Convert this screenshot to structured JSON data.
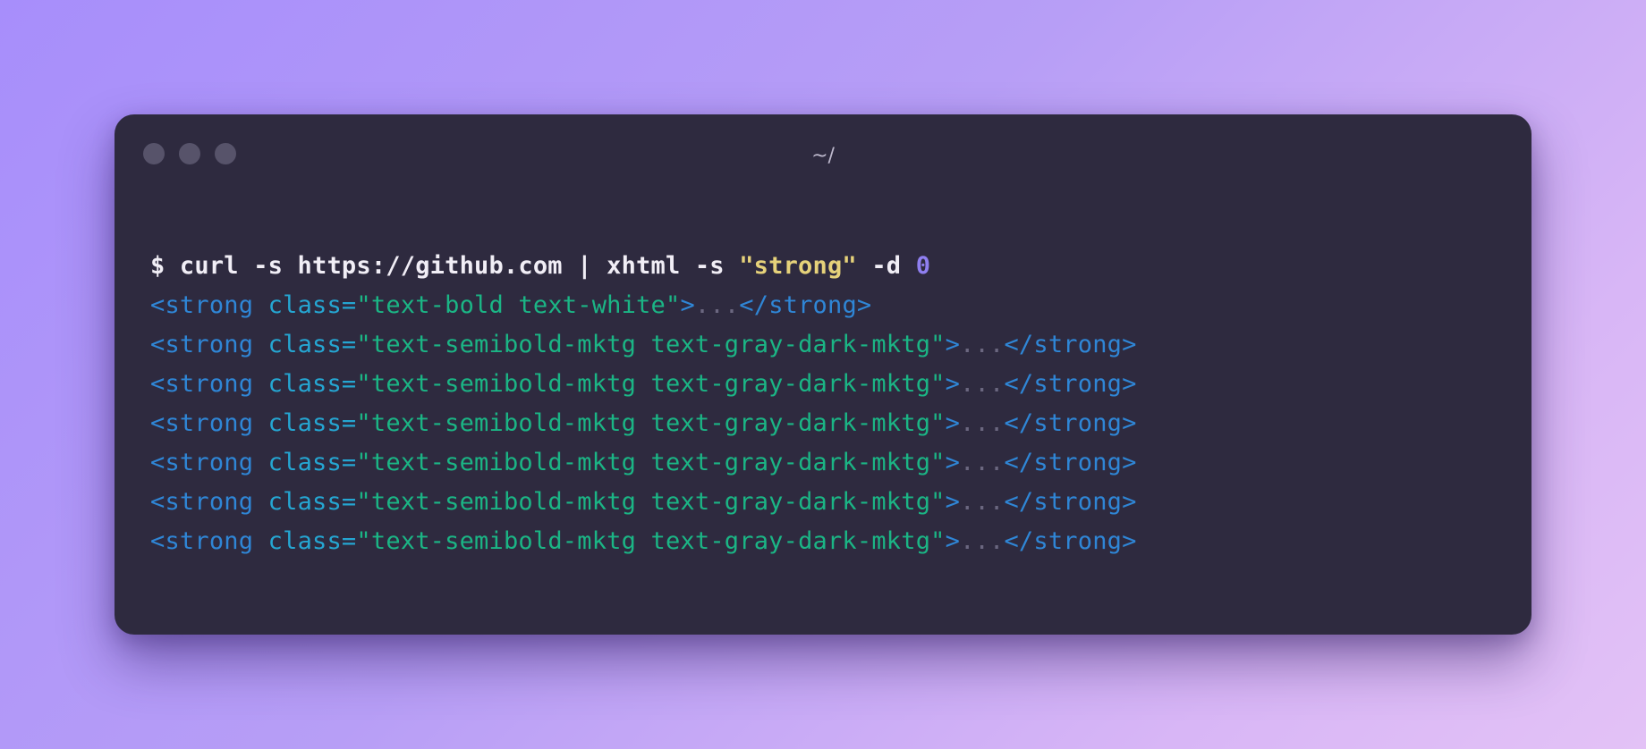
{
  "window": {
    "title": "~/",
    "controls": [
      "close",
      "minimize",
      "maximize"
    ]
  },
  "command": {
    "prefix": "$ curl -s https://github.com | xhtml -s ",
    "selector": "\"strong\"",
    "flag": " -d ",
    "depth": "0"
  },
  "output": [
    {
      "open": "<strong",
      "attr": " class=",
      "value": "\"text-bold text-white\"",
      "gt": ">",
      "ellipsis": "...",
      "close": "</strong>"
    },
    {
      "open": "<strong",
      "attr": " class=",
      "value": "\"text-semibold-mktg text-gray-dark-mktg\"",
      "gt": ">",
      "ellipsis": "...",
      "close": "</strong>"
    },
    {
      "open": "<strong",
      "attr": " class=",
      "value": "\"text-semibold-mktg text-gray-dark-mktg\"",
      "gt": ">",
      "ellipsis": "...",
      "close": "</strong>"
    },
    {
      "open": "<strong",
      "attr": " class=",
      "value": "\"text-semibold-mktg text-gray-dark-mktg\"",
      "gt": ">",
      "ellipsis": "...",
      "close": "</strong>"
    },
    {
      "open": "<strong",
      "attr": " class=",
      "value": "\"text-semibold-mktg text-gray-dark-mktg\"",
      "gt": ">",
      "ellipsis": "...",
      "close": "</strong>"
    },
    {
      "open": "<strong",
      "attr": " class=",
      "value": "\"text-semibold-mktg text-gray-dark-mktg\"",
      "gt": ">",
      "ellipsis": "...",
      "close": "</strong>"
    },
    {
      "open": "<strong",
      "attr": " class=",
      "value": "\"text-semibold-mktg text-gray-dark-mktg\"",
      "gt": ">",
      "ellipsis": "...",
      "close": "</strong>"
    }
  ],
  "colors": {
    "background": "#2e2a3f",
    "command": "#f1eef6",
    "string": "#e6d27a",
    "number": "#8f7ff0",
    "tag": "#2f86d6",
    "attribute": "#25a6d2",
    "attribute_value": "#1bb585",
    "ellipsis": "#6b6780"
  }
}
